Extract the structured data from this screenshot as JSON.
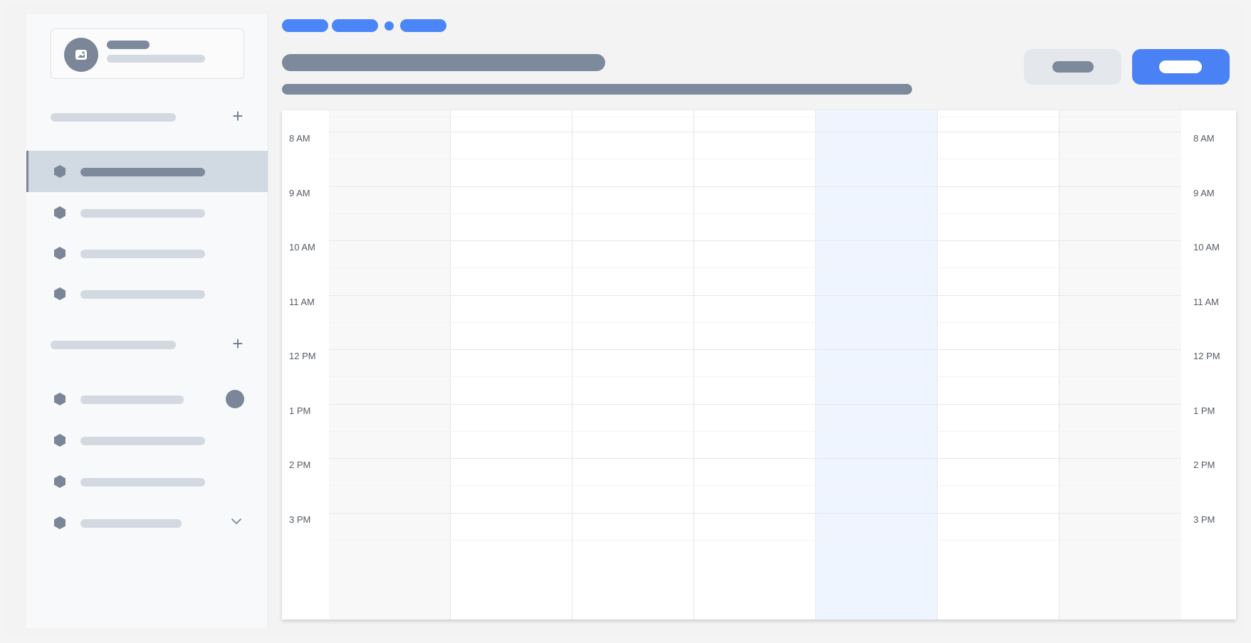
{
  "calendar": {
    "hours_left": [
      "8 AM",
      "9 AM",
      "10 AM",
      "11 AM",
      "12 PM",
      "1 PM",
      "2 PM",
      "3 PM"
    ],
    "hours_right": [
      "8 AM",
      "9 AM",
      "10 AM",
      "11 AM",
      "12 PM",
      "1 PM",
      "2 PM",
      "3 PM"
    ],
    "today_column_index": 4
  },
  "colors": {
    "accent": "#4a86f7",
    "skeleton_dark": "#7c8a9c",
    "skeleton_light": "#d3d9e1",
    "today_highlight": "#eff5fe"
  },
  "icons": {
    "avatar": "image-icon",
    "section_add": "plus-icon",
    "nav_item": "hexagon-icon",
    "expand": "chevron-down-icon"
  }
}
